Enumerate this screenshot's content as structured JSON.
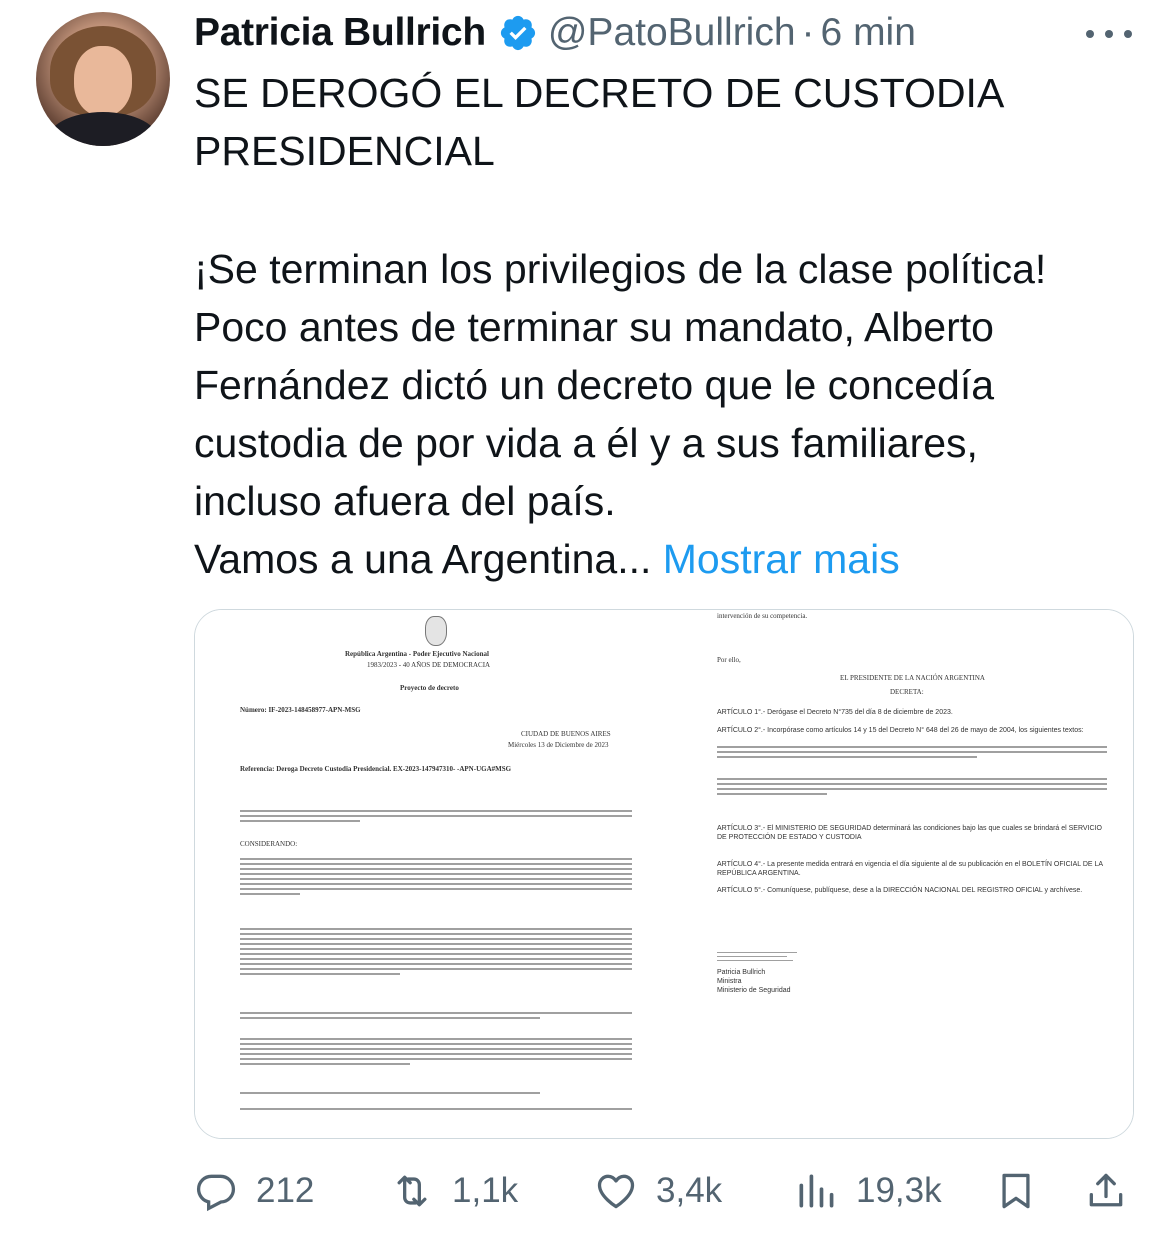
{
  "tweet": {
    "author_name": "Patricia Bullrich",
    "handle": "@PatoBullrich",
    "separator": "·",
    "time": "6 min",
    "text_lines_1": [
      "SE DEROGÓ EL DECRETO DE CUSTODIA",
      "PRESIDENCIAL"
    ],
    "text_lines_2": [
      "¡Se terminan los privilegios de la clase política!",
      "Poco antes de terminar su mandato, Alberto",
      "Fernández dictó un decreto que le concedía",
      "custodia de por vida a él y a sus familiares,",
      "incluso afuera del país."
    ],
    "last_line": "Vamos a una Argentina...",
    "show_more": "Mostrar mais"
  },
  "document": {
    "left": {
      "header_1": "República Argentina - Poder Ejecutivo Nacional",
      "header_2": "1983/2023 - 40 AÑOS DE DEMOCRACIA",
      "title": "Proyecto de decreto",
      "numero": "Número: IF-2023-148458977-APN-MSG",
      "ciudad": "CIUDAD DE BUENOS AIRES",
      "fecha": "Miércoles 13 de Diciembre de 2023",
      "referencia": "Referencia: Deroga Decreto Custodia Presidencial. EX-2023-147947310- -APN-UGA#MSG",
      "considerando": "CONSIDERANDO:"
    },
    "right": {
      "top_line": "intervención de su competencia.",
      "por_ello": "Por ello,",
      "presidente": "EL PRESIDENTE DE LA NACIÓN ARGENTINA",
      "decreta": "DECRETA:",
      "art1": "ARTÍCULO 1°.- Derógase el Decreto N°735 del día 8 de diciembre de 2023.",
      "art2": "ARTÍCULO 2°.- Incorpórase como artículos 14 y 15 del Decreto N° 648 del 26 de mayo de 2004, los siguientes textos:",
      "art3": "ARTÍCULO 3°.- El MINISTERIO DE SEGURIDAD determinará las condiciones bajo las que cuales se brindará el SERVICIO DE PROTECCIÓN DE ESTADO Y CUSTODIA",
      "art4": "ARTÍCULO 4°.- La presente medida entrará en vigencia el día siguiente al de su publicación en el BOLETÍN OFICIAL DE LA REPÚBLICA ARGENTINA.",
      "art5": "ARTÍCULO 5°.- Comuníquese, publíquese, dese a la DIRECCIÓN NACIONAL DEL REGISTRO OFICIAL y archívese.",
      "firma_1": "Patricia Bullrich",
      "firma_2": "Ministra",
      "firma_3": "Ministerio de Seguridad"
    }
  },
  "actions": {
    "replies": "212",
    "reposts": "1,1k",
    "likes": "3,4k",
    "views": "19,3k"
  },
  "colors": {
    "text": "#0f1419",
    "secondary": "#536471",
    "link": "#1d9bf0",
    "verified": "#1d9bf0",
    "border": "#cfd9de"
  }
}
